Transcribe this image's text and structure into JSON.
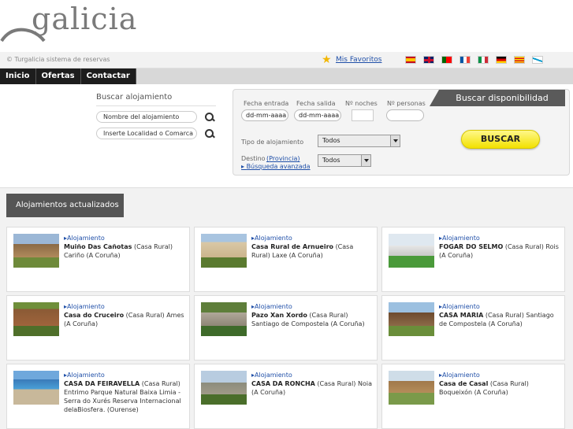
{
  "logo": {
    "text": "galicia"
  },
  "topbar": {
    "copyright": "© Turgalicia sistema de reservas",
    "favorites": "Mis Favoritos",
    "flags": [
      "es",
      "en",
      "pt",
      "fr",
      "it",
      "de",
      "ca",
      "gl"
    ]
  },
  "nav": {
    "items": [
      "Inicio",
      "Ofertas",
      "Contactar"
    ]
  },
  "search_left": {
    "title": "Buscar alojamiento",
    "name_placeholder": "Nombre del alojamiento",
    "locality_placeholder": "Inserte Localidad o Comarca"
  },
  "availability": {
    "tab": "Buscar disponibilidad",
    "checkin_label": "Fecha entrada",
    "checkin_value": "dd-mm-aaaa",
    "checkout_label": "Fecha salida",
    "checkout_value": "dd-mm-aaaa",
    "nights_label": "Nº noches",
    "persons_label": "Nº personas",
    "type_label": "Tipo de alojamiento",
    "type_value": "Todos",
    "destination_label": "Destino",
    "province_link": "Provincia",
    "advanced_link": "Búsqueda avanzada",
    "destination_value": "Todos",
    "search_button": "BUSCAR"
  },
  "results": {
    "title": "Alojamientos actualizados",
    "cards": [
      {
        "type": "Alojamiento",
        "name": "Muiño Das Cañotas",
        "category": "(Casa Rural)",
        "location": "Cariño (A Coruña)"
      },
      {
        "type": "Alojamiento",
        "name": "Casa Rural de Arnueiro",
        "category": "(Casa Rural)",
        "location": "Laxe (A Coruña)"
      },
      {
        "type": "Alojamiento",
        "name": "FOGAR DO SELMO",
        "category": "(Casa Rural)",
        "location": "Rois (A Coruña)"
      },
      {
        "type": "Alojamiento",
        "name": "Casa do Cruceiro",
        "category": "(Casa Rural) Ames",
        "location": "(A Coruña)"
      },
      {
        "type": "Alojamiento",
        "name": "Pazo Xan Xordo",
        "category": "(Casa Rural)",
        "location": "Santiago de Compostela (A Coruña)"
      },
      {
        "type": "Alojamiento",
        "name": "CASA MARIA",
        "category": "(Casa Rural) Santiago",
        "location": "de Compostela (A Coruña)"
      },
      {
        "type": "Alojamiento",
        "name": "CASA DA FEIRAVELLA",
        "category": "(Casa Rural)",
        "location": "Entrimo Parque Natural Baixa Limia - Serra do Xurés Reserva Internacional delaBiosfera. (Ourense)"
      },
      {
        "type": "Alojamiento",
        "name": "CASA DA RONCHA",
        "category": "(Casa Rural)",
        "location": "Noia (A Coruña)"
      },
      {
        "type": "Alojamiento",
        "name": "Casa de Casal",
        "category": "(Casa Rural)",
        "location": "Boqueixón (A Coruña)"
      }
    ]
  },
  "colors": {
    "nav_bg": "#1d1d1d",
    "tab_bg": "#555555",
    "link": "#1f4fa8",
    "button": "#f2e100"
  }
}
